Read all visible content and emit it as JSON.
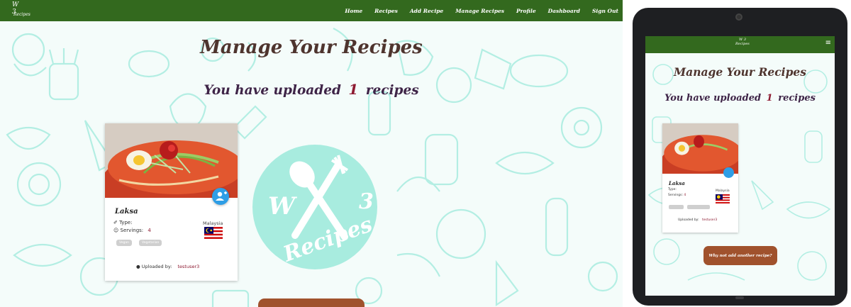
{
  "navbar": {
    "brand": {
      "mark": "W 3",
      "text": "Recipes"
    },
    "links": [
      "Home",
      "Recipes",
      "Add Recipe",
      "Manage Recipes",
      "Profile",
      "Dashboard",
      "Sign Out"
    ]
  },
  "main": {
    "title": "Manage Your Recipes",
    "count_prefix": "You have uploaded",
    "count_value": "1",
    "count_suffix": "recipes",
    "center_logo": {
      "mark_left": "W",
      "mark_right": "3",
      "text": "Recipes"
    }
  },
  "recipe_card": {
    "name": "Laksa",
    "type_label": "Type:",
    "servings_label": "Servings:",
    "servings_value": "4",
    "country": "Malaysia",
    "tags": [
      "Vegan",
      "Vegetarian"
    ],
    "uploaded_label": "Uploaded by:",
    "uploaded_by": "testuser3"
  },
  "tablet": {
    "add_button_label": "Why not add another recipe?"
  },
  "colors": {
    "navbar": "#33691e",
    "title": "#4e342e",
    "accent_count": "#8e1b32",
    "add_button": "#a0522d",
    "fab": "#2e9ee6",
    "doodle": "#a8ecdf"
  },
  "icons": {
    "menu": "hamburger-icon",
    "user_fab": "user-plus-icon",
    "type": "utensil-icon",
    "servings": "users-icon",
    "uploader": "user-icon"
  }
}
